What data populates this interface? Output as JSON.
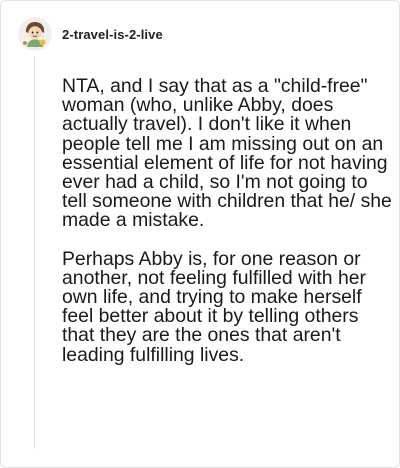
{
  "comment": {
    "username": "2-travel-is-2-live",
    "avatar_icon": "user-avatar-icon",
    "paragraphs": [
      "NTA, and I say that as a \"child-free\" woman (who, unlike Abby, does actually travel). I don't like it when people tell me I am missing out on an essential element of life for not having ever had a child, so I'm not going to tell someone with children that he/ she made a mistake.",
      "Perhaps Abby is, for one reason or another, not feeling fulfilled with her own life, and trying to make herself feel better about it by telling others that they are the ones that aren't leading fulfilling lives."
    ]
  },
  "colors": {
    "border": "#e2e2e2",
    "thread_line": "#e4e4e4",
    "text": "#1a1a1a",
    "avatar_background": "#f1efe9"
  }
}
